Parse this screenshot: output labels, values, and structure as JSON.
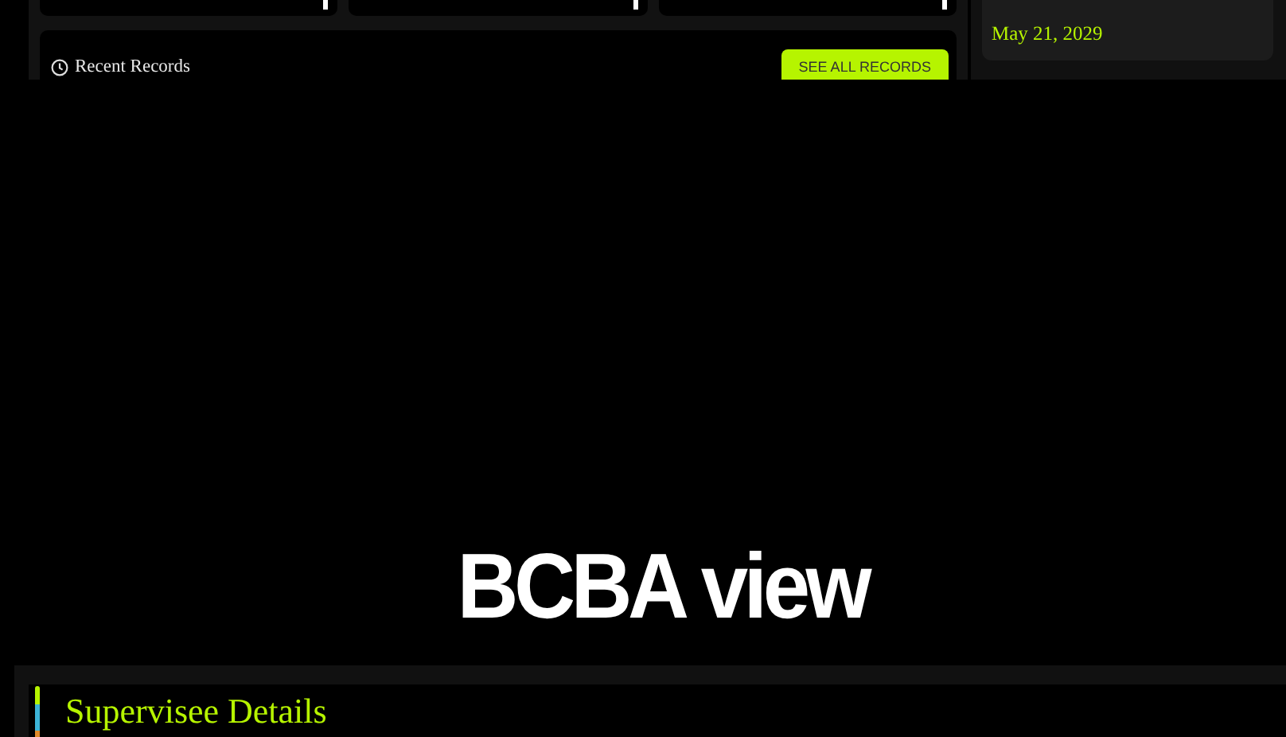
{
  "stat_cards": [
    {
      "kind": "cut-off"
    },
    {
      "kind": "cut-off"
    },
    {
      "kind": "cut-off"
    }
  ],
  "recent_records": {
    "title": "Recent Records",
    "button": "SEE ALL RECORDS"
  },
  "side_card": {
    "date": "May 21, 2029"
  },
  "caption": "BCBA view",
  "details_panel": {
    "title": "Supervisee Details"
  }
}
